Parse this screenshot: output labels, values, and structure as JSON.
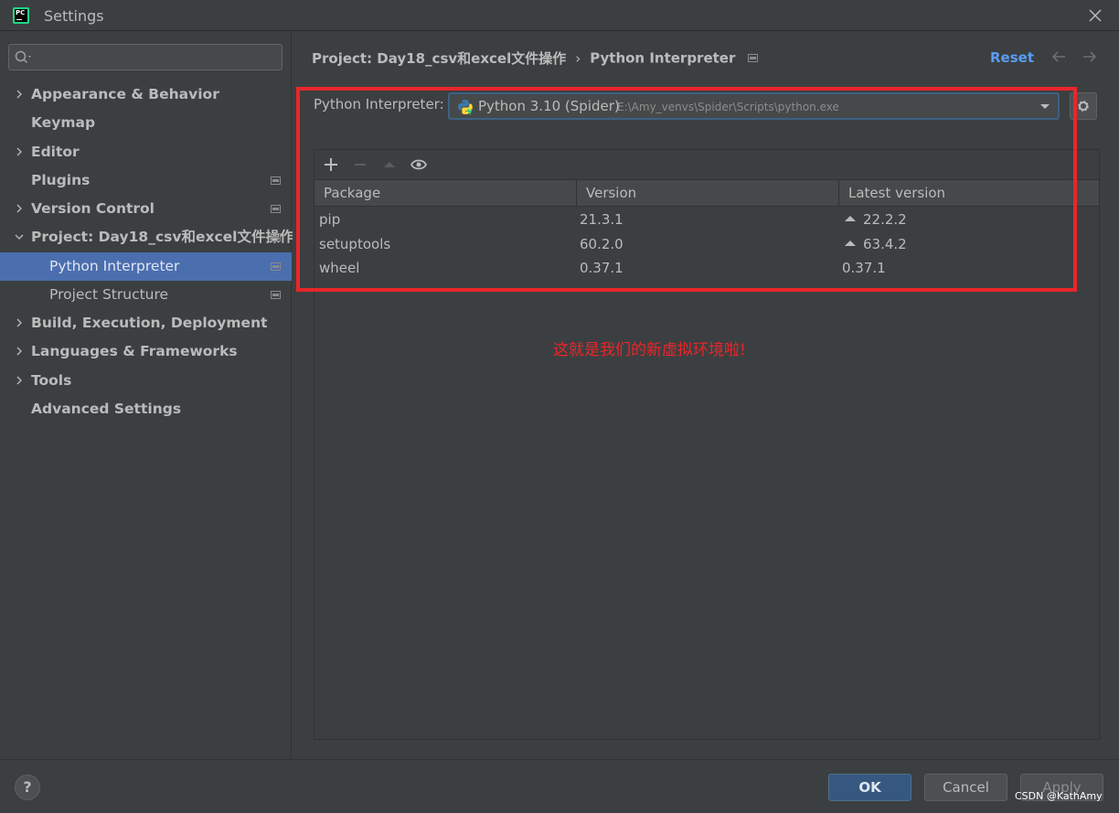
{
  "window": {
    "title": "Settings",
    "logo_text": "PC"
  },
  "sidebar": {
    "search_placeholder": "",
    "items": [
      {
        "label": "Appearance & Behavior"
      },
      {
        "label": "Keymap"
      },
      {
        "label": "Editor"
      },
      {
        "label": "Plugins"
      },
      {
        "label": "Version Control"
      },
      {
        "label": "Project: Day18_csv和excel文件操作"
      },
      {
        "label": "Python Interpreter",
        "selected": true
      },
      {
        "label": "Project Structure"
      },
      {
        "label": "Build, Execution, Deployment"
      },
      {
        "label": "Languages & Frameworks"
      },
      {
        "label": "Tools"
      },
      {
        "label": "Advanced Settings"
      }
    ]
  },
  "breadcrumb": {
    "project": "Project: Day18_csv和excel文件操作",
    "separator": "›",
    "current": "Python Interpreter"
  },
  "actions": {
    "reset": "Reset"
  },
  "interpreter": {
    "label": "Python Interpreter:",
    "name": "Python 3.10 (Spider)",
    "path": "E:\\Amy_venvs\\Spider\\Scripts\\python.exe"
  },
  "packages": {
    "columns": [
      "Package",
      "Version",
      "Latest version"
    ],
    "rows": [
      {
        "package": "pip",
        "version": "21.3.1",
        "latest": "22.2.2",
        "upgrade": true
      },
      {
        "package": "setuptools",
        "version": "60.2.0",
        "latest": "63.4.2",
        "upgrade": true
      },
      {
        "package": "wheel",
        "version": "0.37.1",
        "latest": "0.37.1",
        "upgrade": false
      }
    ]
  },
  "annotation": {
    "text": "这就是我们的新虚拟环境啦!",
    "color": "#e8262a"
  },
  "footer": {
    "help": "?",
    "ok": "OK",
    "cancel": "Cancel",
    "apply": "Apply"
  },
  "watermark": "CSDN @KathAmy",
  "colors": {
    "accent": "#4b6eaf",
    "link": "#589df6",
    "annotation_red": "#e8262a"
  }
}
